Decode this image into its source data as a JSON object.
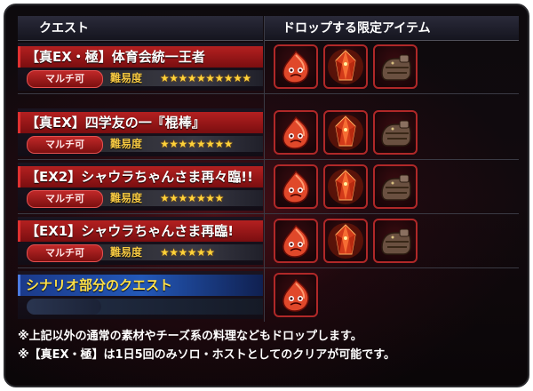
{
  "headers": {
    "quest": "クエスト",
    "drops": "ドロップする限定アイテム"
  },
  "quests": [
    {
      "title": "【真EX・極】体育会統一王者",
      "multi": "マルチ可",
      "difficulty_label": "難易度",
      "stars": 10,
      "drops": [
        "red-demon-material-icon",
        "crimson-crystal-icon",
        "leather-gauntlet-icon"
      ]
    },
    {
      "title": "【真EX】四学友の一『棍棒』",
      "multi": "マルチ可",
      "difficulty_label": "難易度",
      "stars": 8,
      "drops": [
        "red-demon-material-icon",
        "crimson-crystal-icon",
        "leather-gauntlet-icon"
      ]
    },
    {
      "title": "【EX2】シャウラちゃんさま再々臨!!",
      "multi": "マルチ可",
      "difficulty_label": "難易度",
      "stars": 7,
      "drops": [
        "red-demon-material-icon",
        "crimson-crystal-icon",
        "leather-gauntlet-icon"
      ]
    },
    {
      "title": "【EX1】シャウラちゃんさま再臨!",
      "multi": "マルチ可",
      "difficulty_label": "難易度",
      "stars": 6,
      "drops": [
        "red-demon-material-icon",
        "crimson-crystal-icon",
        "leather-gauntlet-icon"
      ]
    }
  ],
  "scenario": {
    "title": "シナリオ部分のクエスト",
    "drops": [
      "red-demon-material-icon"
    ]
  },
  "notes": [
    "※上記以外の通常の素材やチーズ系の料理などもドロップします。",
    "※【真EX・極】は1日5回のみソロ・ホストとしてのクリアが可能です。"
  ],
  "colors": {
    "quest_title_bg": "#9a1818",
    "scenario_title_bg": "#2358b8",
    "scenario_title_text": "#ffe14a",
    "difficulty_text": "#f5c842",
    "star": "#ffd23a",
    "item_border": "#b02828"
  }
}
